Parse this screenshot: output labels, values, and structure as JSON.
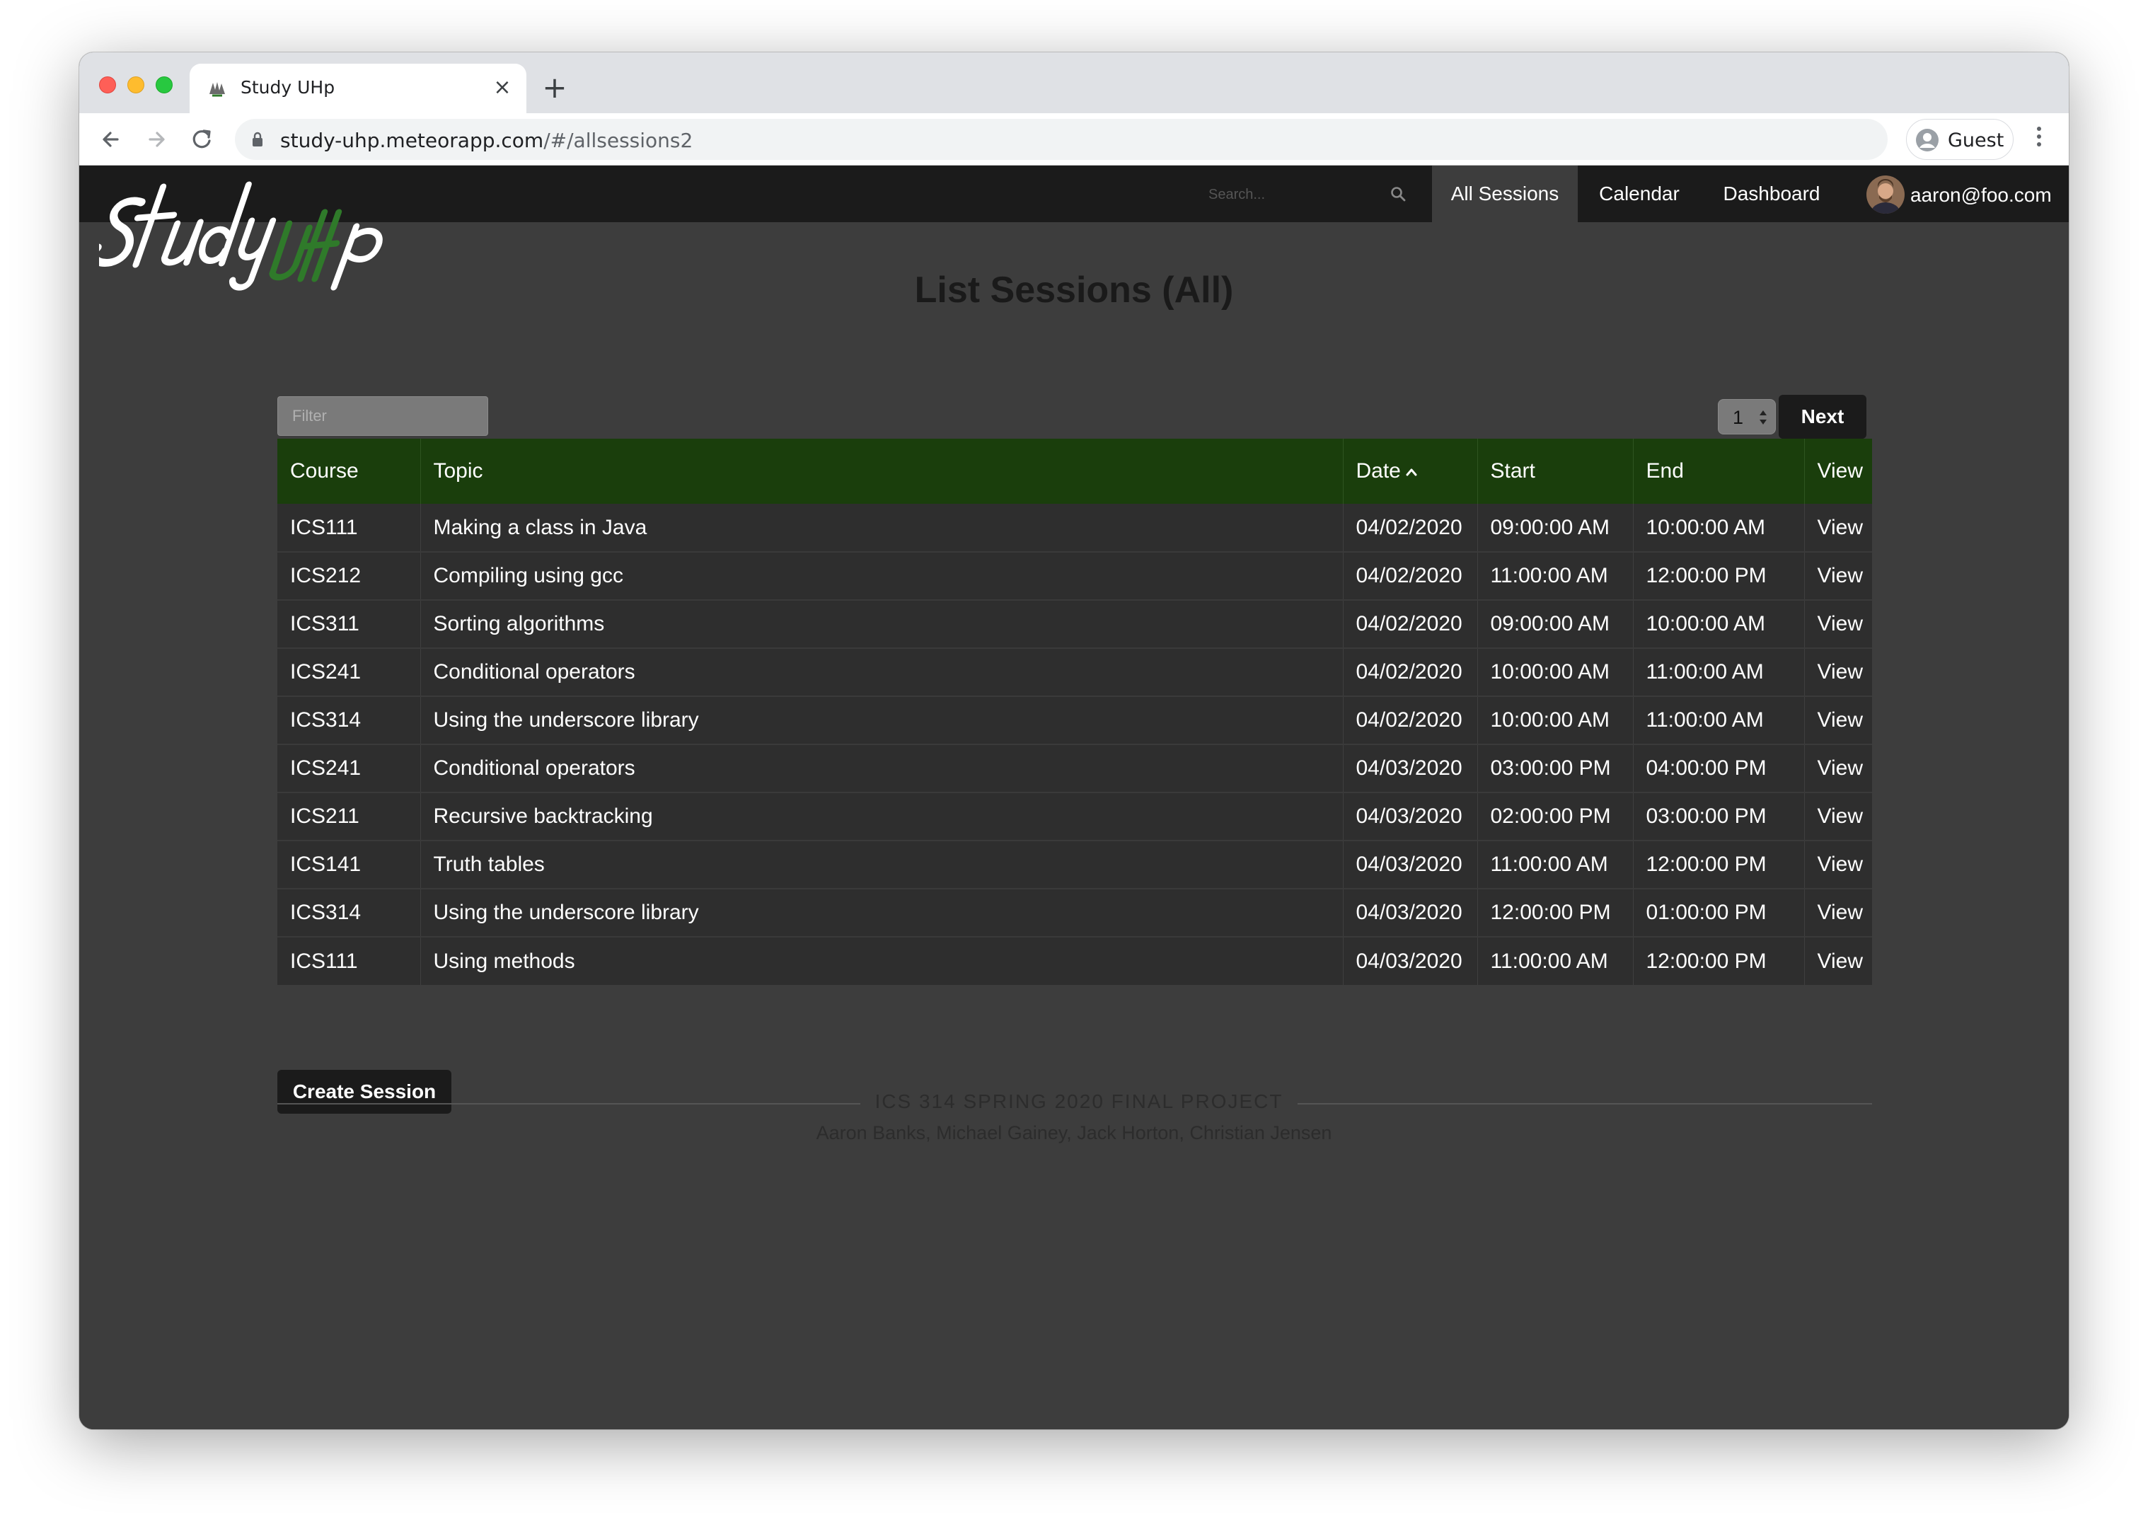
{
  "browser": {
    "tab_title": "Study UHp",
    "new_tab": "+",
    "close_tab": "×",
    "url_host": "study-uhp.meteorapp.com",
    "url_path": "/#/allsessions2",
    "profile_label": "Guest"
  },
  "navbar": {
    "logo_alt": "Study UHp",
    "search_placeholder": "Search...",
    "items": [
      {
        "label": "All Sessions",
        "active": true
      },
      {
        "label": "Calendar",
        "active": false
      },
      {
        "label": "Dashboard",
        "active": false
      }
    ],
    "user_email": "aaron@foo.com"
  },
  "main": {
    "title": "List Sessions (All)",
    "filter_placeholder": "Filter",
    "page_number": "1",
    "next_label": "Next",
    "create_label": "Create Session"
  },
  "table": {
    "columns": [
      "Course",
      "Topic",
      "Date",
      "Start",
      "End",
      "View"
    ],
    "sorted_column": "Date",
    "rows": [
      {
        "course": "ICS111",
        "topic": "Making a class in Java",
        "date": "04/02/2020",
        "start": "09:00:00 AM",
        "end": "10:00:00 AM",
        "view": "View"
      },
      {
        "course": "ICS212",
        "topic": "Compiling using gcc",
        "date": "04/02/2020",
        "start": "11:00:00 AM",
        "end": "12:00:00 PM",
        "view": "View"
      },
      {
        "course": "ICS311",
        "topic": "Sorting algorithms",
        "date": "04/02/2020",
        "start": "09:00:00 AM",
        "end": "10:00:00 AM",
        "view": "View"
      },
      {
        "course": "ICS241",
        "topic": "Conditional operators",
        "date": "04/02/2020",
        "start": "10:00:00 AM",
        "end": "11:00:00 AM",
        "view": "View"
      },
      {
        "course": "ICS314",
        "topic": "Using the underscore library",
        "date": "04/02/2020",
        "start": "10:00:00 AM",
        "end": "11:00:00 AM",
        "view": "View"
      },
      {
        "course": "ICS241",
        "topic": "Conditional operators",
        "date": "04/03/2020",
        "start": "03:00:00 PM",
        "end": "04:00:00 PM",
        "view": "View"
      },
      {
        "course": "ICS211",
        "topic": "Recursive backtracking",
        "date": "04/03/2020",
        "start": "02:00:00 PM",
        "end": "03:00:00 PM",
        "view": "View"
      },
      {
        "course": "ICS141",
        "topic": "Truth tables",
        "date": "04/03/2020",
        "start": "11:00:00 AM",
        "end": "12:00:00 PM",
        "view": "View"
      },
      {
        "course": "ICS314",
        "topic": "Using the underscore library",
        "date": "04/03/2020",
        "start": "12:00:00 PM",
        "end": "01:00:00 PM",
        "view": "View"
      },
      {
        "course": "ICS111",
        "topic": "Using methods",
        "date": "04/03/2020",
        "start": "11:00:00 AM",
        "end": "12:00:00 PM",
        "view": "View"
      }
    ]
  },
  "footer": {
    "title": "ICS 314 SPRING 2020 FINAL PROJECT",
    "authors": "Aaron Banks, Michael Gainey, Jack Horton, Christian Jensen"
  },
  "colors": {
    "page_bg": "#3d3d3d",
    "navbar_bg": "#1b1b1b",
    "table_header_bg": "#1a3e0c",
    "row_bg": "#2e2e2e",
    "logo_accent": "#2f7a2a"
  },
  "icons": {
    "back": "arrow-left-icon",
    "forward": "arrow-right-icon",
    "reload": "reload-icon",
    "lock": "lock-icon",
    "profile": "person-icon",
    "menu": "kebab-menu-icon",
    "search": "search-icon",
    "sort": "caret-up-icon"
  }
}
